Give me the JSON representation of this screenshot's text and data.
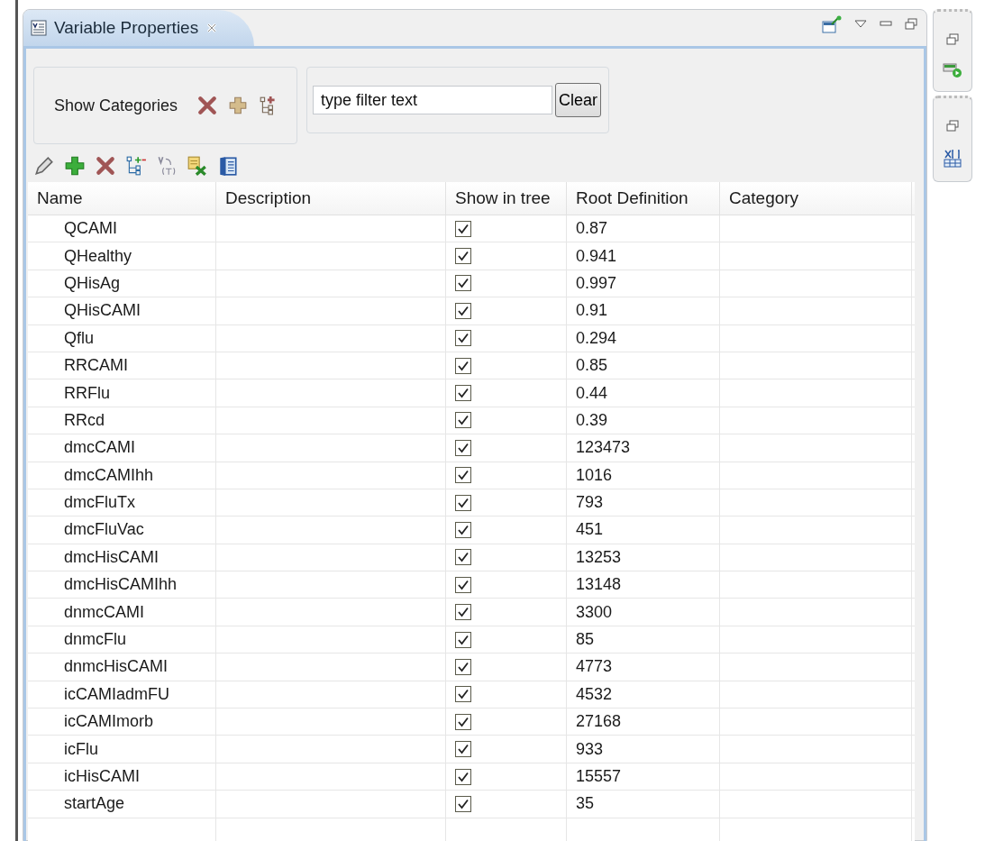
{
  "view": {
    "title": "Variable Properties"
  },
  "categories": {
    "label": "Show Categories"
  },
  "filter": {
    "placeholder": "type filter text",
    "button": "Clear"
  },
  "table": {
    "columns": [
      "Name",
      "Description",
      "Show in tree",
      "Root Definition",
      "Category"
    ],
    "rows": [
      {
        "name": "QCAMI",
        "show_in_tree": true,
        "root_definition": "0.87"
      },
      {
        "name": "QHealthy",
        "show_in_tree": true,
        "root_definition": "0.941"
      },
      {
        "name": "QHisAg",
        "show_in_tree": true,
        "root_definition": "0.997"
      },
      {
        "name": "QHisCAMI",
        "show_in_tree": true,
        "root_definition": "0.91"
      },
      {
        "name": "Qflu",
        "show_in_tree": true,
        "root_definition": "0.294"
      },
      {
        "name": "RRCAMI",
        "show_in_tree": true,
        "root_definition": "0.85"
      },
      {
        "name": "RRFlu",
        "show_in_tree": true,
        "root_definition": "0.44"
      },
      {
        "name": "RRcd",
        "show_in_tree": true,
        "root_definition": "0.39"
      },
      {
        "name": "dmcCAMI",
        "show_in_tree": true,
        "root_definition": "123473"
      },
      {
        "name": "dmcCAMIhh",
        "show_in_tree": true,
        "root_definition": "1016"
      },
      {
        "name": "dmcFluTx",
        "show_in_tree": true,
        "root_definition": "793"
      },
      {
        "name": "dmcFluVac",
        "show_in_tree": true,
        "root_definition": "451"
      },
      {
        "name": "dmcHisCAMI",
        "show_in_tree": true,
        "root_definition": "13253"
      },
      {
        "name": "dmcHisCAMIhh",
        "show_in_tree": true,
        "root_definition": "13148"
      },
      {
        "name": "dnmcCAMI",
        "show_in_tree": true,
        "root_definition": "3300"
      },
      {
        "name": "dnmcFlu",
        "show_in_tree": true,
        "root_definition": "85"
      },
      {
        "name": "dnmcHisCAMI",
        "show_in_tree": true,
        "root_definition": "4773"
      },
      {
        "name": "icCAMIadmFU",
        "show_in_tree": true,
        "root_definition": "4532"
      },
      {
        "name": "icCAMImorb",
        "show_in_tree": true,
        "root_definition": "27168"
      },
      {
        "name": "icFlu",
        "show_in_tree": true,
        "root_definition": "933"
      },
      {
        "name": "icHisCAMI",
        "show_in_tree": true,
        "root_definition": "15557"
      },
      {
        "name": "startAge",
        "show_in_tree": true,
        "root_definition": "35"
      }
    ]
  }
}
